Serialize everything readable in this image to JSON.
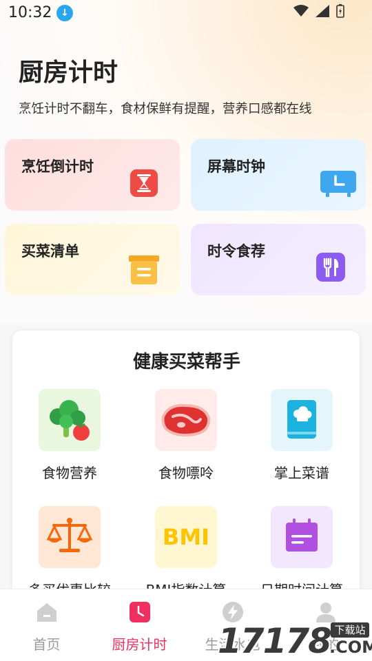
{
  "status": {
    "time": "10:32"
  },
  "header": {
    "title": "厨房计时",
    "subtitle": "烹饪计时不翻车，食材保鲜有提醒，营养口感都在线"
  },
  "cards": [
    {
      "label": "烹饪倒计时",
      "icon": "hourglass-icon",
      "color": "#ef4b45"
    },
    {
      "label": "屏幕时钟",
      "icon": "clock-screen-icon",
      "color": "#3ea7f0"
    },
    {
      "label": "买菜清单",
      "icon": "box-list-icon",
      "color": "#f7b23a"
    },
    {
      "label": "时令食荐",
      "icon": "fork-knife-icon",
      "color": "#8c5cf2"
    }
  ],
  "helper": {
    "title": "健康买菜帮手",
    "tools": [
      {
        "label": "食物营养",
        "icon": "broccoli-icon"
      },
      {
        "label": "食物嘌呤",
        "icon": "meat-icon"
      },
      {
        "label": "掌上菜谱",
        "icon": "recipe-book-icon"
      },
      {
        "label": "多买优惠比较",
        "icon": "scale-icon"
      },
      {
        "label": "BMI指数计算",
        "icon": "bmi-icon",
        "badge": "BMI"
      },
      {
        "label": "日期时间计算",
        "icon": "calendar-icon"
      }
    ]
  },
  "tabbar": {
    "tabs": [
      {
        "label": "首页",
        "icon": "home-icon"
      },
      {
        "label": "厨房计时",
        "icon": "timer-tab-icon",
        "active": true
      },
      {
        "label": "生活水电",
        "icon": "lightning-icon"
      },
      {
        "label": "我的",
        "icon": "person-icon"
      }
    ]
  },
  "watermark": {
    "text": "17178",
    "suffix": ".COM",
    "badge": "下载站"
  }
}
